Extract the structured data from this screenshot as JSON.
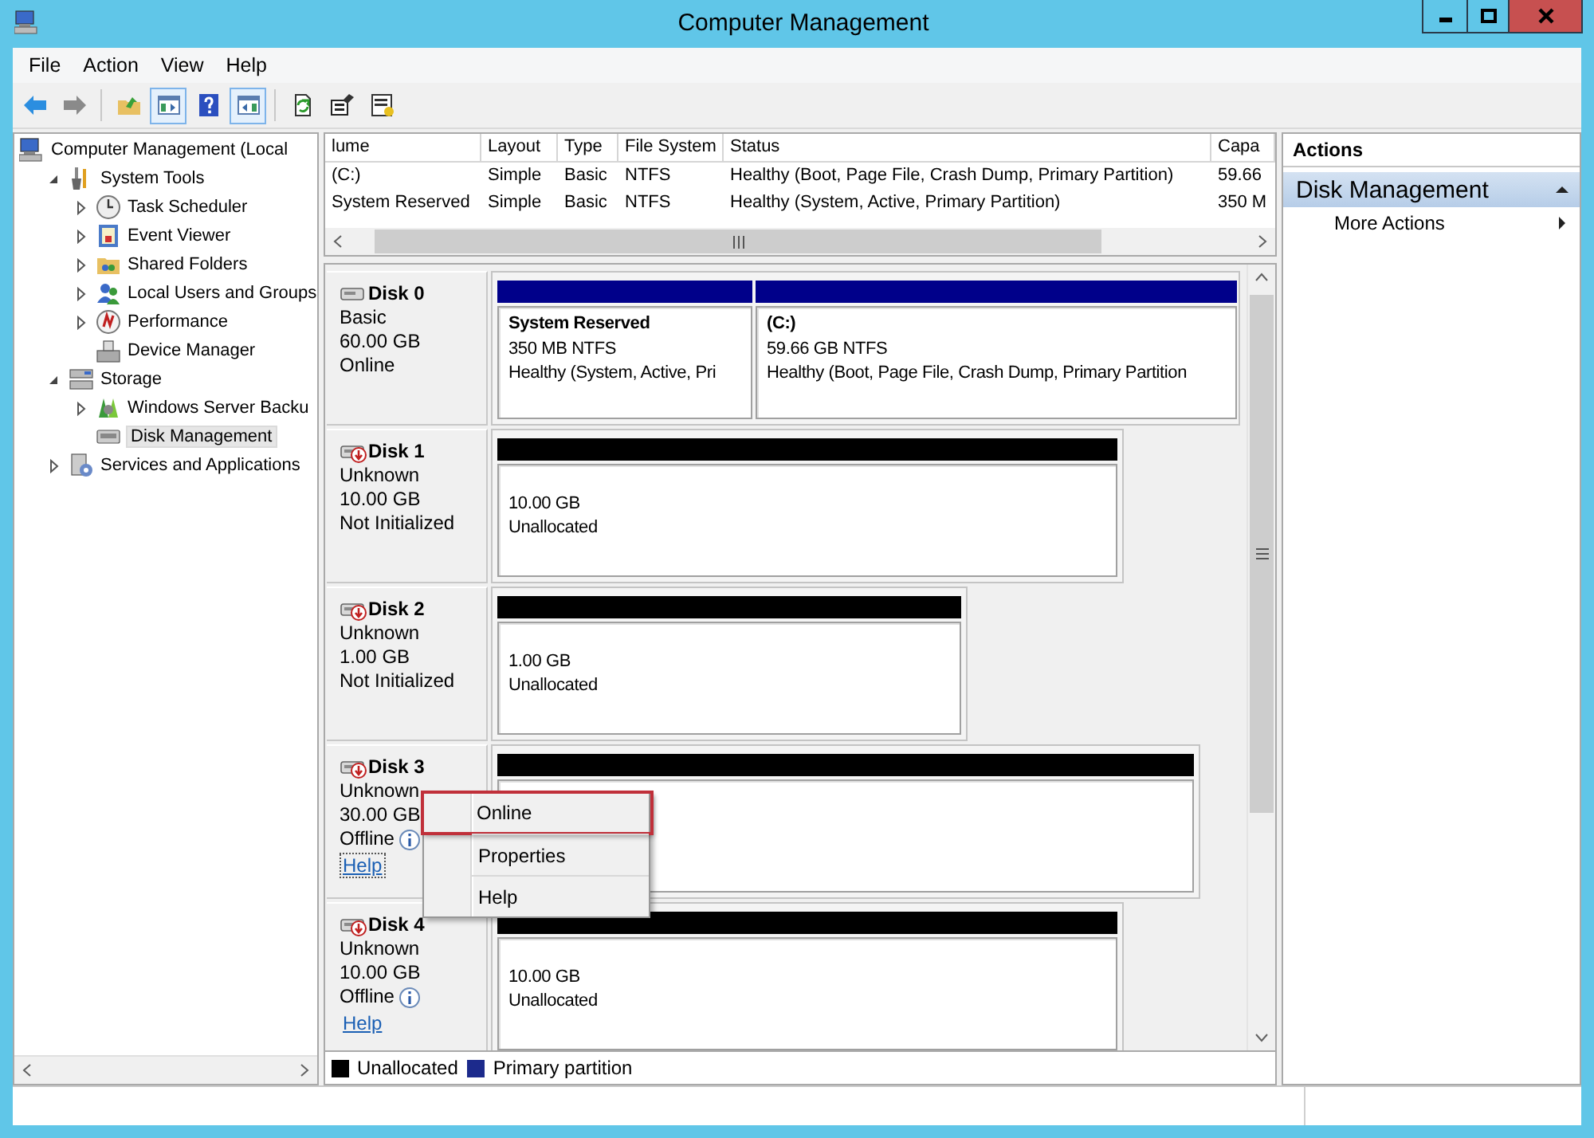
{
  "window": {
    "title": "Computer Management"
  },
  "menu": [
    "File",
    "Action",
    "View",
    "Help"
  ],
  "toolbar": [
    {
      "kind": "back",
      "pressed": false
    },
    {
      "kind": "forward",
      "pressed": false
    },
    {
      "kind": "separator"
    },
    {
      "kind": "up",
      "pressed": false
    },
    {
      "kind": "tree_pane",
      "pressed": true
    },
    {
      "kind": "help",
      "pressed": false
    },
    {
      "kind": "action_pane",
      "pressed": true
    },
    {
      "kind": "separator"
    },
    {
      "kind": "refresh",
      "pressed": false
    },
    {
      "kind": "properties",
      "pressed": false
    },
    {
      "kind": "export",
      "pressed": false
    }
  ],
  "tree": {
    "items": [
      {
        "label": "Computer Management (Local",
        "selected": false,
        "children": [
          {
            "label": "System Tools",
            "expanded": true,
            "selected": false,
            "children": [
              {
                "label": "Task Scheduler",
                "expanded": false,
                "selected": false
              },
              {
                "label": "Event Viewer",
                "expanded": false,
                "selected": false
              },
              {
                "label": "Shared Folders",
                "expanded": false,
                "selected": false
              },
              {
                "label": "Local Users and Groups",
                "expanded": false,
                "selected": false
              },
              {
                "label": "Performance",
                "expanded": false,
                "selected": false
              },
              {
                "label": "Device Manager",
                "selected": false
              }
            ]
          },
          {
            "label": "Storage",
            "expanded": true,
            "selected": false,
            "children": [
              {
                "label": "Windows Server Backu",
                "expanded": false,
                "selected": false
              },
              {
                "label": "Disk Management",
                "selected": true
              }
            ]
          },
          {
            "label": "Services and Applications",
            "expanded": false,
            "selected": false
          }
        ]
      }
    ]
  },
  "volumes": {
    "columns": [
      "lume",
      "Layout",
      "Type",
      "File System",
      "Status",
      "Capa"
    ],
    "rows": [
      [
        "(C:)",
        "Simple",
        "Basic",
        "NTFS",
        "Healthy (Boot, Page File, Crash Dump, Primary Partition)",
        "59.66"
      ],
      [
        "System Reserved",
        "Simple",
        "Basic",
        "NTFS",
        "Healthy (System, Active, Primary Partition)",
        "350 M"
      ]
    ]
  },
  "disks": [
    {
      "name": "Disk 0",
      "type": "Basic",
      "size": "60.00 GB",
      "status": "Online",
      "warning": false,
      "info": false,
      "partitions": [
        {
          "kind": "primary",
          "label": "System Reserved",
          "size": "350 MB NTFS",
          "status": "Healthy (System, Active, Pri"
        },
        {
          "kind": "primary",
          "label": "(C:)",
          "size": "59.66 GB NTFS",
          "status": "Healthy (Boot, Page File, Crash Dump, Primary Partition"
        }
      ]
    },
    {
      "name": "Disk 1",
      "type": "Unknown",
      "size": "10.00 GB",
      "status": "Not Initialized",
      "warning": true,
      "info": false,
      "partitions": [
        {
          "kind": "unallocated",
          "size": "10.00 GB",
          "status": "Unallocated"
        }
      ]
    },
    {
      "name": "Disk 2",
      "type": "Unknown",
      "size": "1.00 GB",
      "status": "Not Initialized",
      "warning": true,
      "info": false,
      "partitions": [
        {
          "kind": "unallocated",
          "size": "1.00 GB",
          "status": "Unallocated"
        }
      ]
    },
    {
      "name": "Disk 3",
      "type": "Unknown",
      "size": "30.00 GB",
      "status": "Offline",
      "warning": true,
      "info": true,
      "help": "Help",
      "help_focused": true,
      "partitions": [
        {
          "kind": "unallocated"
        }
      ]
    },
    {
      "name": "Disk 4",
      "type": "Unknown",
      "size": "10.00 GB",
      "status": "Offline",
      "warning": true,
      "info": true,
      "help": "Help",
      "help_focused": false,
      "partitions": [
        {
          "kind": "unallocated",
          "size": "10.00 GB",
          "status": "Unallocated"
        }
      ]
    }
  ],
  "legend": [
    {
      "label": "Unallocated",
      "color": "#000000"
    },
    {
      "label": "Primary partition",
      "color": "#1c2a8c"
    }
  ],
  "actions": {
    "title": "Actions",
    "sections": [
      {
        "title": "Disk Management",
        "expanded": true,
        "items": [
          {
            "label": "More Actions"
          }
        ]
      }
    ]
  },
  "context_menu": {
    "items": [
      {
        "label": "Online",
        "highlighted": true
      },
      {
        "label": "Properties",
        "highlighted": false
      },
      {
        "label": "Help",
        "highlighted": false
      }
    ]
  }
}
